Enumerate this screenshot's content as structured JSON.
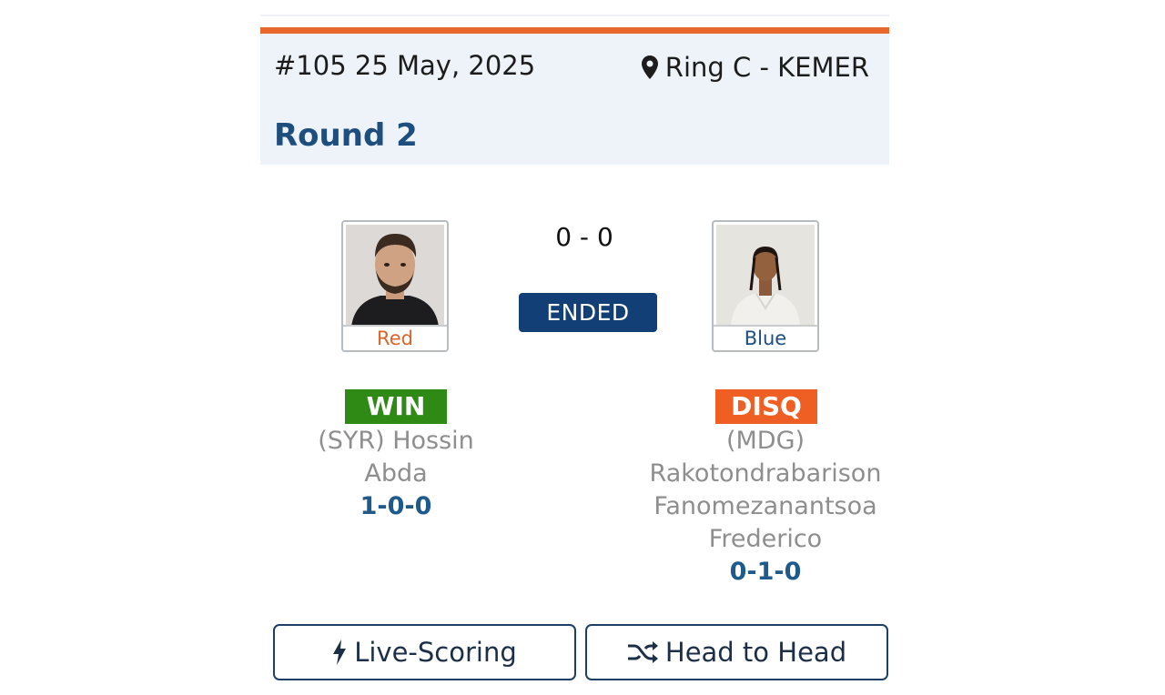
{
  "bout": {
    "number_date": "#105 25 May, 2025",
    "ring": "Ring C - KEMER",
    "round": "Round 2"
  },
  "match": {
    "score": "0 - 0",
    "status": "ENDED"
  },
  "red": {
    "corner_label": "Red",
    "result": "WIN",
    "country_name_line1": "(SYR) Hossin",
    "name_line2": "Abda",
    "record": "1-0-0"
  },
  "blue": {
    "corner_label": "Blue",
    "result": "DISQ",
    "country": "(MDG)",
    "name_line1": "Rakotondrabarison",
    "name_line2": "Fanomezanantsoa",
    "name_line3": "Frederico",
    "record": "0-1-0"
  },
  "actions": {
    "live_scoring": "Live-Scoring",
    "head_to_head": "Head to Head"
  },
  "icons": {
    "location": "map-marker-icon",
    "bolt": "bolt-icon",
    "shuffle": "shuffle-icon"
  },
  "colors": {
    "accent": "#e8672c",
    "header_bg": "#eef3fa",
    "round_text": "#1d4e7e",
    "status_badge": "#123f75",
    "win": "#2e8a15",
    "disq": "#ef5f23",
    "record": "#1e5a8c"
  }
}
